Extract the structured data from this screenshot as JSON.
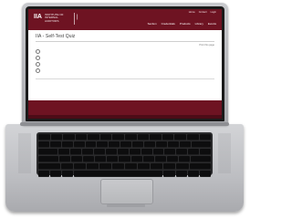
{
  "site": {
    "logo_mark": "IIA",
    "logo_text": "INSTITUTE OF INTERNAL AUDITORS",
    "badge": "|",
    "top_links": [
      "Home",
      "Contact",
      "Login"
    ],
    "nav": [
      "Section",
      "Credentials",
      "Products",
      "Library",
      "Events"
    ]
  },
  "page": {
    "title": "IIA - Self-Test Quiz",
    "util_link": "Print this page",
    "intro_lines": [
      "",
      "",
      ""
    ],
    "questions": [
      "",
      "",
      "",
      ""
    ],
    "footer_left": "",
    "footer_right": "",
    "bottom_text": ""
  },
  "colors": {
    "brand": "#6e1322",
    "screen_bg": "#ffffff",
    "laptop": "#bdbec2"
  }
}
